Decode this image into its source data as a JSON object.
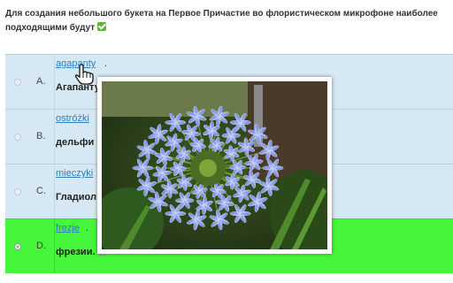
{
  "question": {
    "text": "Для создания небольшого букета на Первое Причастие во флористическом микрофоне наиболее подходящими будут"
  },
  "options": [
    {
      "letter": "A.",
      "word": "agapanty",
      "answer": "Агапанту"
    },
    {
      "letter": "B.",
      "word": "ostróżki",
      "answer": "дельфи"
    },
    {
      "letter": "C.",
      "word": "mieczyki",
      "answer": "Гладиол"
    },
    {
      "letter": "D.",
      "word": "frezje",
      "answer": "фрезии.",
      "selected": true
    }
  ],
  "colors": {
    "option_bg": "#d6e8f3",
    "selected_bg": "#45f63a",
    "link": "#2a7fbf",
    "check": "#5fb832"
  },
  "icons": {
    "check": "check-mark-icon",
    "cursor": "hand-pointer-icon",
    "radio": "radio-icon"
  }
}
